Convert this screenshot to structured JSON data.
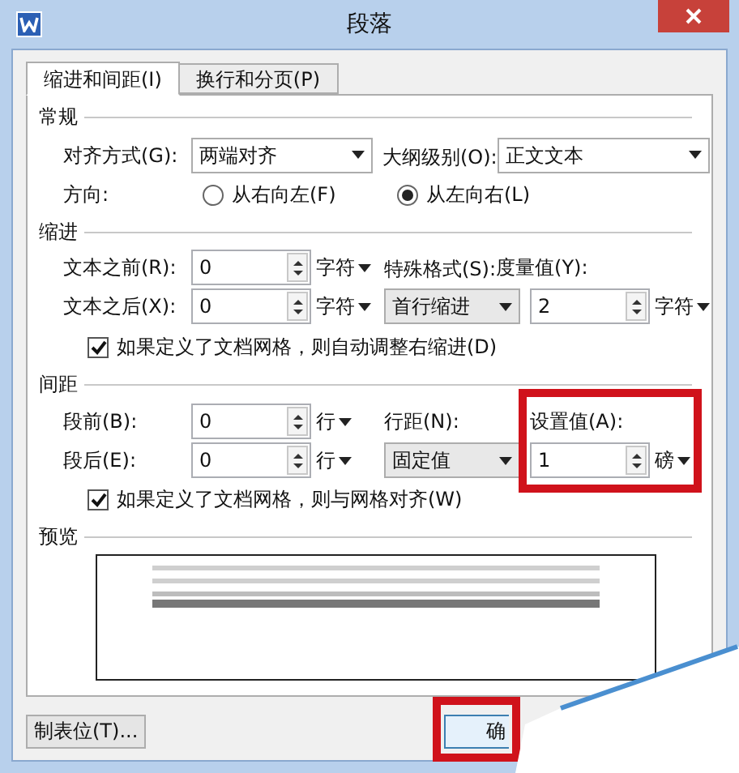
{
  "window": {
    "title": "段落"
  },
  "tabs": [
    {
      "label": "缩进和间距(I)",
      "selected": true
    },
    {
      "label": "换行和分页(P)",
      "selected": false
    }
  ],
  "general": {
    "heading": "常规",
    "alignment": {
      "label": "对齐方式(G):",
      "value": "两端对齐"
    },
    "outline_level": {
      "label": "大纲级别(O):",
      "value": "正文文本"
    },
    "direction": {
      "label": "方向:",
      "options": [
        {
          "label": "从右向左(F)",
          "selected": false
        },
        {
          "label": "从左向右(L)",
          "selected": true
        }
      ]
    }
  },
  "indent": {
    "heading": "缩进",
    "before": {
      "label": "文本之前(R):",
      "value": "0",
      "unit": "字符"
    },
    "after": {
      "label": "文本之后(X):",
      "value": "0",
      "unit": "字符"
    },
    "special": {
      "label": "特殊格式(S):",
      "value": "首行缩进"
    },
    "measure": {
      "label": "度量值(Y):",
      "value": "2",
      "unit": "字符"
    },
    "auto_adjust": {
      "label": "如果定义了文档网格，则自动调整右缩进(D)",
      "checked": true
    }
  },
  "spacing": {
    "heading": "间距",
    "before": {
      "label": "段前(B):",
      "value": "0",
      "unit": "行"
    },
    "after": {
      "label": "段后(E):",
      "value": "0",
      "unit": "行"
    },
    "line_spacing": {
      "label": "行距(N):",
      "value": "固定值"
    },
    "set_value": {
      "label": "设置值(A):",
      "value": "1",
      "unit": "磅",
      "highlighted": true
    },
    "snap": {
      "label": "如果定义了文档网格，则与网格对齐(W)",
      "checked": true
    }
  },
  "preview": {
    "heading": "预览"
  },
  "buttons": [
    {
      "label": "制表位(T)...",
      "highlighted": false
    },
    {
      "label": "确",
      "highlighted": true
    }
  ]
}
